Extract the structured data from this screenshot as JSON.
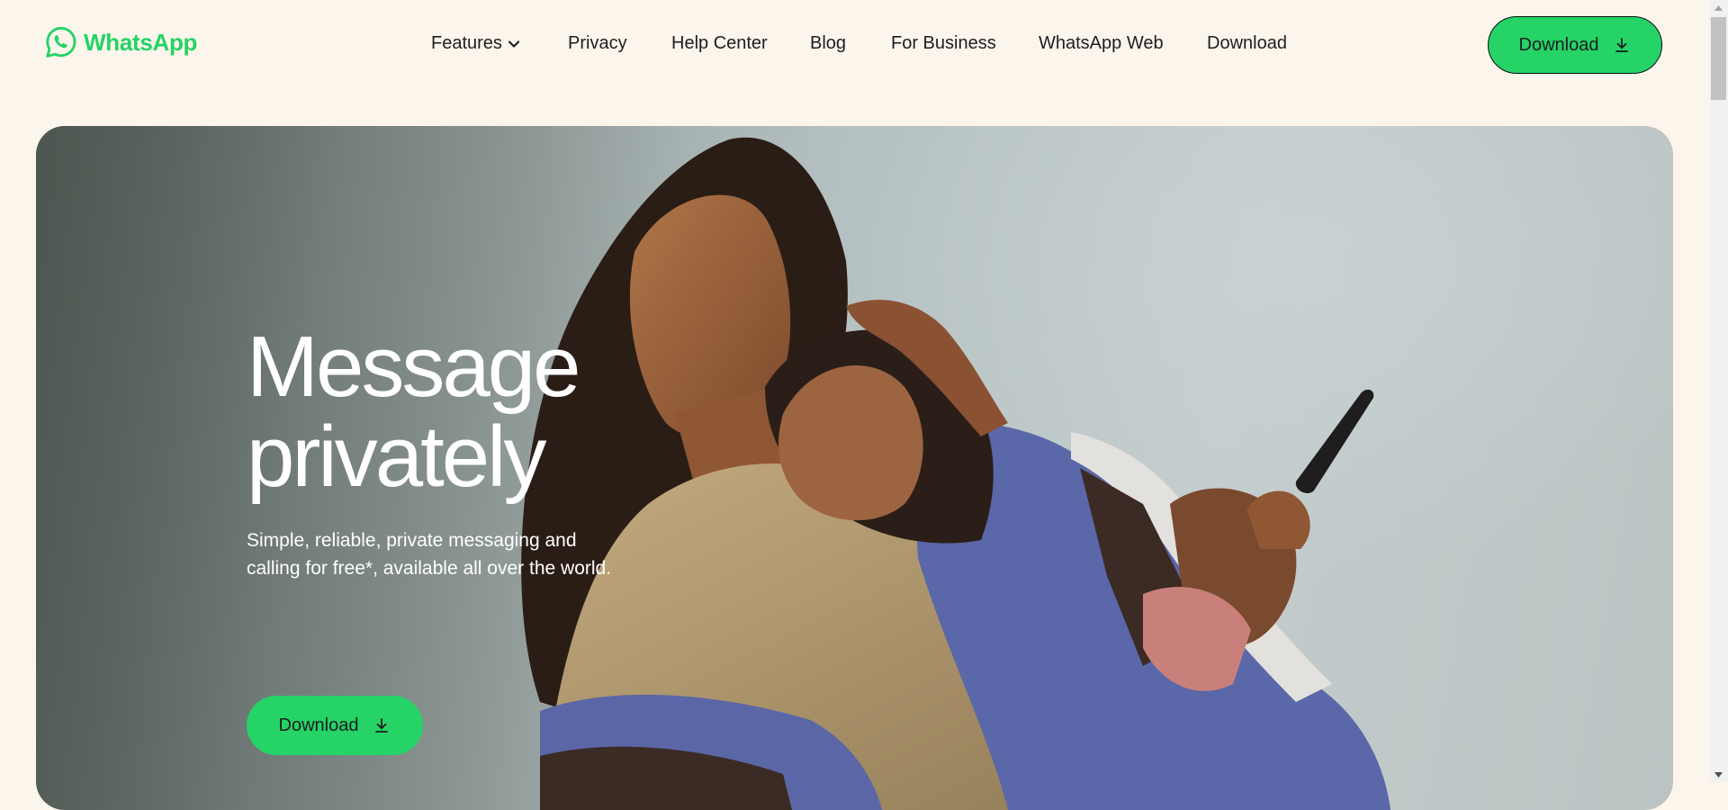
{
  "brand": {
    "name": "WhatsApp",
    "color": "#25d366"
  },
  "nav": {
    "items": [
      {
        "label": "Features",
        "icon": "chevron-down-icon"
      },
      {
        "label": "Privacy"
      },
      {
        "label": "Help Center"
      },
      {
        "label": "Blog"
      },
      {
        "label": "For Business"
      },
      {
        "label": "WhatsApp Web"
      },
      {
        "label": "Download"
      }
    ],
    "download_button": {
      "label": "Download",
      "icon": "download-icon"
    }
  },
  "hero": {
    "title_line1": "Message",
    "title_line2": "privately",
    "subtitle": "Simple, reliable, private messaging and calling for free*, available all over the world.",
    "download_button": {
      "label": "Download",
      "icon": "download-icon"
    },
    "image_icon": "hero-photo"
  },
  "colors": {
    "background": "#fcf5eb",
    "accent": "#25d366",
    "text": "#1c1e21"
  }
}
